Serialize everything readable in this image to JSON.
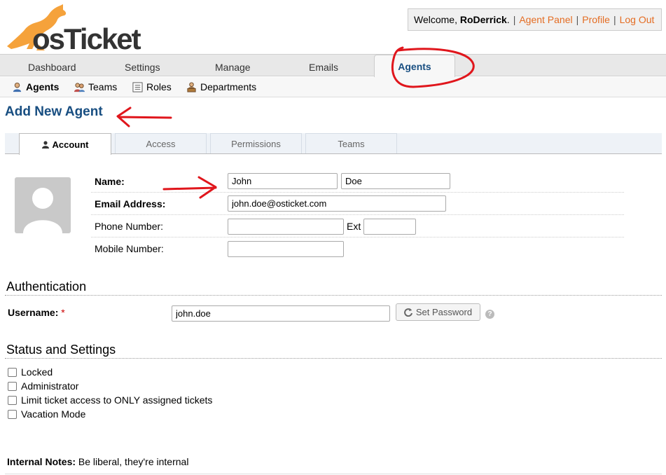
{
  "header": {
    "logo_text": "osTicket",
    "welcome_prefix": "Welcome, ",
    "username": "RoDerrick",
    "welcome_suffix": ".",
    "links": [
      "Agent Panel",
      "Profile",
      "Log Out"
    ]
  },
  "nav": {
    "tabs": [
      "Dashboard",
      "Settings",
      "Manage",
      "Emails",
      "Agents"
    ],
    "active": "Agents"
  },
  "subnav": {
    "items": [
      {
        "label": "Agents",
        "icon": "agent-icon"
      },
      {
        "label": "Teams",
        "icon": "teams-icon"
      },
      {
        "label": "Roles",
        "icon": "roles-icon"
      },
      {
        "label": "Departments",
        "icon": "departments-icon"
      }
    ]
  },
  "page": {
    "title": "Add New Agent"
  },
  "form_tabs": [
    "Account",
    "Access",
    "Permissions",
    "Teams"
  ],
  "account": {
    "name_label": "Name:",
    "first_name": "John",
    "last_name": "Doe",
    "email_label": "Email Address:",
    "email": "john.doe@osticket.com",
    "phone_label": "Phone Number:",
    "phone": "",
    "ext_label": "Ext",
    "ext": "",
    "mobile_label": "Mobile Number:",
    "mobile": ""
  },
  "authentication": {
    "title": "Authentication",
    "username_label": "Username:",
    "required_mark": "*",
    "username": "john.doe",
    "set_password_label": "Set Password",
    "help_glyph": "?"
  },
  "status": {
    "title": "Status and Settings",
    "options": [
      {
        "label": "Locked",
        "checked": false
      },
      {
        "label": "Administrator",
        "checked": false
      },
      {
        "label": "Limit ticket access to ONLY assigned tickets",
        "checked": false
      },
      {
        "label": "Vacation Mode",
        "checked": false
      }
    ]
  },
  "notes": {
    "label": "Internal Notes:",
    "text": "Be liberal, they're internal"
  },
  "colors": {
    "brand_blue": "#184e81",
    "link_orange": "#e46c22",
    "annotation_red": "#e0161c"
  }
}
